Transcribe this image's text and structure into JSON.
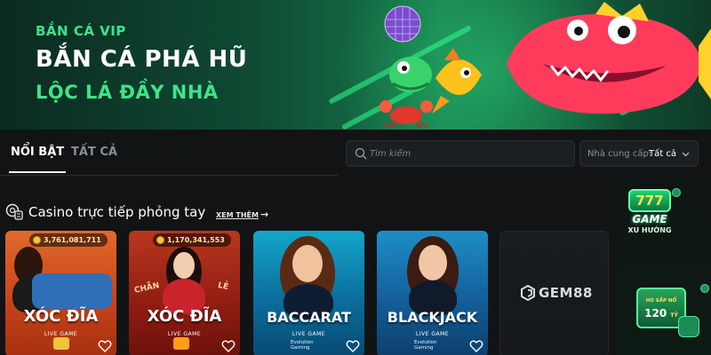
{
  "banner": {
    "kicker": "BẮN CÁ VIP",
    "title": "BẮN CÁ PHÁ HŨ",
    "subtitle": "LỘC LÁ ĐẦY NHÀ"
  },
  "tabs": [
    {
      "label": "NỔI BẬT",
      "active": true
    },
    {
      "label": "TẤT CẢ",
      "active": false
    }
  ],
  "search": {
    "placeholder": "Tìm kiếm",
    "icon": "search-icon"
  },
  "provider": {
    "label": "Nhà cung cấp:",
    "value": "Tất cả",
    "icon": "chevron-down-icon"
  },
  "section": {
    "title": "Casino trực tiếp phỏng tay",
    "see_more": "XEM THÊM",
    "icon": "casino-chip-icon"
  },
  "cards": [
    {
      "title": "XÓC ĐĨA",
      "subtitle": "LIVE GAME",
      "jackpot": "3,761,081,711"
    },
    {
      "title": "XÓC ĐĨA",
      "subtitle": "LIVE GAME",
      "jackpot": "1,170,341,553",
      "table_label_left": "CHẴN",
      "table_label_right": "LẺ"
    },
    {
      "title": "BACCARAT",
      "subtitle": "LIVE GAME",
      "provider_line1": "Evolution",
      "provider_line2": "Gaming"
    },
    {
      "title": "BLACKJACK",
      "subtitle": "LIVE GAME",
      "provider_line1": "Evolution",
      "provider_line2": "Gaming"
    },
    {
      "title": "GEM88",
      "icon": "gem88-logo-icon"
    }
  ],
  "promo": {
    "game_badge_number": "777",
    "game_badge_label": "GAME",
    "game_badge_caption": "XU HƯỚNG",
    "jackpot_caption": "HŨ SẮP NỔ",
    "jackpot_amount": "120",
    "jackpot_unit": "TỶ"
  },
  "colors": {
    "accent_green": "#3fe38a",
    "background": "#111315",
    "panel": "#1c1f22"
  }
}
